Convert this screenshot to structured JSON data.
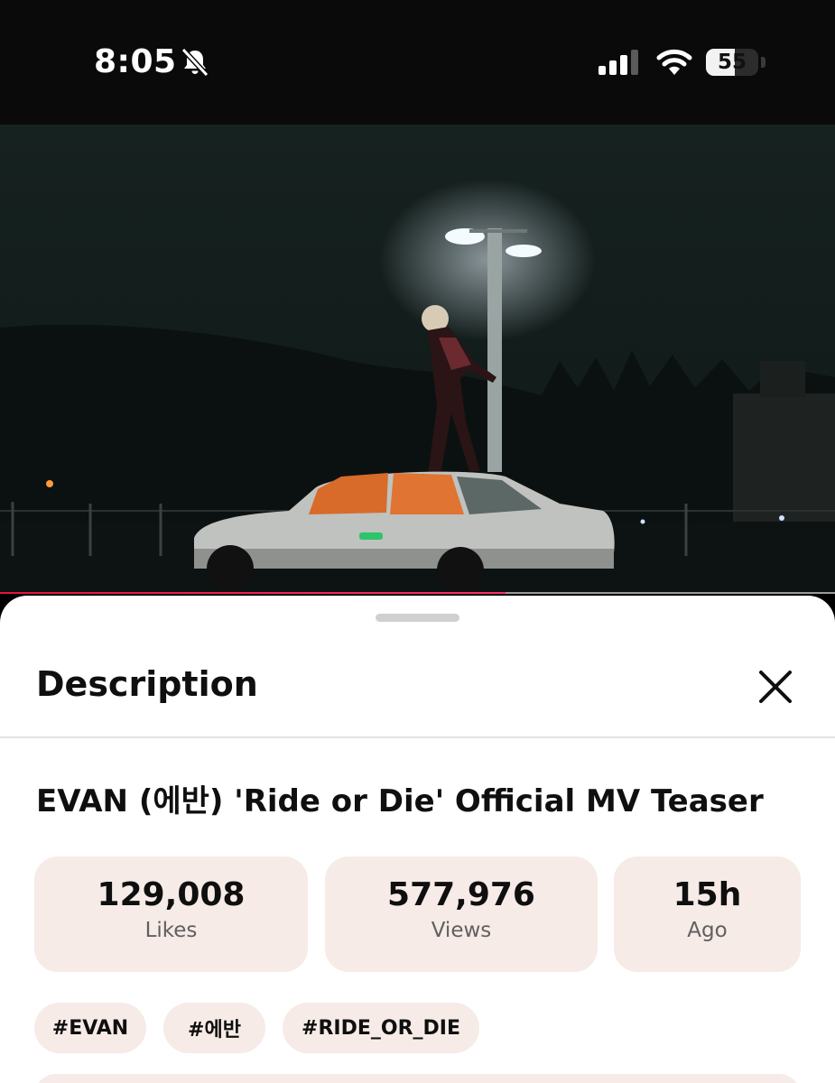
{
  "status_bar": {
    "time": "8:05",
    "battery_percent": "55",
    "battery_level": 0.55,
    "icons": [
      "bell-slash-icon",
      "cellular-signal-icon",
      "wifi-icon",
      "battery-icon"
    ]
  },
  "video": {
    "progress": 0.605,
    "progress_color": "#ff2f6b"
  },
  "description_panel": {
    "heading": "Description",
    "close_icon": "close-icon",
    "video_title": "EVAN (에반) 'Ride or Die' Official MV Teaser",
    "stats": [
      {
        "value": "129,008",
        "label": "Likes"
      },
      {
        "value": "577,976",
        "label": "Views"
      },
      {
        "value": "15h",
        "label": "Ago"
      }
    ],
    "hashtags": [
      "#EVAN",
      "#에반",
      "#RIDE_OR_DIE"
    ]
  },
  "colors": {
    "sheet_background": "#ffffff",
    "card_background": "#f6ebe6",
    "accent": "#e5153a"
  }
}
